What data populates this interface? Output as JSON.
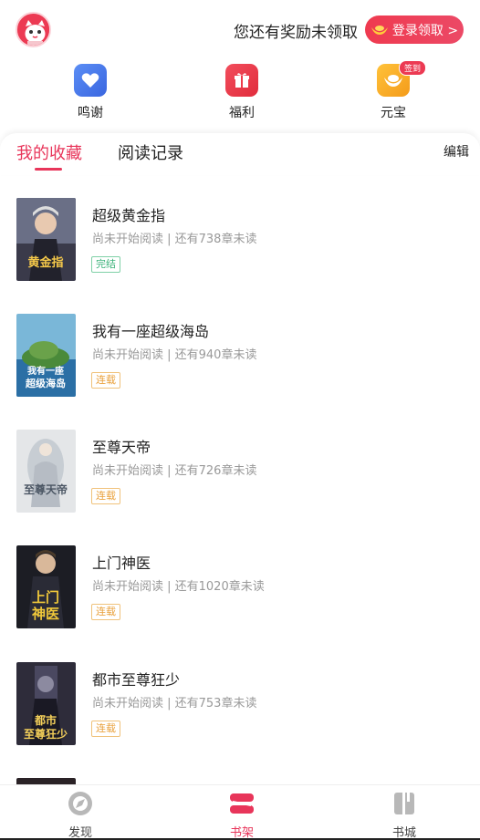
{
  "header": {
    "avatar_icon": "cat-mascot-icon",
    "reward_text": "您还有奖励未领取",
    "login_button_label": "登录领取 >",
    "accent": "#e8355a"
  },
  "quick_entries": [
    {
      "label": "鸣谢",
      "icon": "heart-icon",
      "color": "#4a7cf0"
    },
    {
      "label": "福利",
      "icon": "gift-icon",
      "color": "#ee3a4a"
    },
    {
      "label": "元宝",
      "icon": "ingot-icon",
      "color": "#f6a623",
      "badge": "签到"
    }
  ],
  "tabs": {
    "active": "我的收藏",
    "inactive": "阅读记录",
    "edit_label": "编辑"
  },
  "books": [
    {
      "title": "超级黄金指",
      "meta": "尚未开始阅读 | 还有738章未读",
      "tag": "完结",
      "cover_text": "黄金指"
    },
    {
      "title": "我有一座超级海岛",
      "meta": "尚未开始阅读 | 还有940章未读",
      "tag": "连载",
      "cover_text": "我有一座超级海岛"
    },
    {
      "title": "至尊天帝",
      "meta": "尚未开始阅读 | 还有726章未读",
      "tag": "连载",
      "cover_text": "至尊天帝"
    },
    {
      "title": "上门神医",
      "meta": "尚未开始阅读 | 还有1020章未读",
      "tag": "连载",
      "cover_text": "上门神医"
    },
    {
      "title": "都市至尊狂少",
      "meta": "尚未开始阅读 | 还有753章未读",
      "tag": "连载",
      "cover_text": "都市至尊狂少"
    }
  ],
  "bottom_nav": [
    {
      "label": "发现",
      "icon": "compass-icon"
    },
    {
      "label": "书架",
      "icon": "bookshelf-icon",
      "active": true
    },
    {
      "label": "书城",
      "icon": "book-icon"
    }
  ]
}
